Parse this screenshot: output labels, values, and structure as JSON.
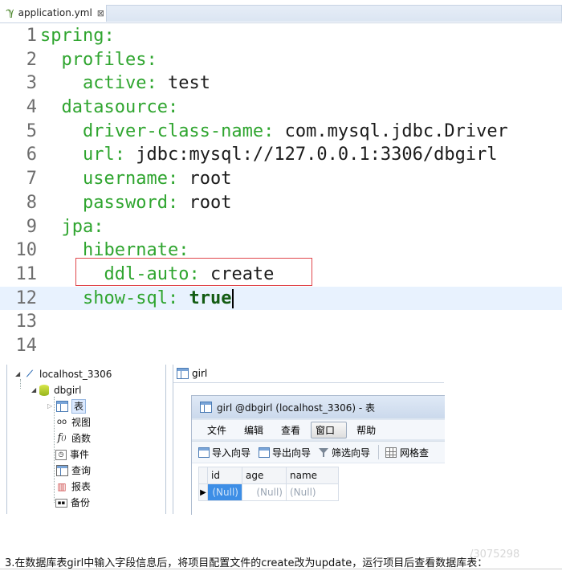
{
  "editor": {
    "tab_title": "application.yml",
    "tab_close": "⊠",
    "lines": [
      {
        "num": "1",
        "indent": "",
        "key": "spring:",
        "value": ""
      },
      {
        "num": "2",
        "indent": "  ",
        "key": "profiles:",
        "value": ""
      },
      {
        "num": "3",
        "indent": "    ",
        "key": "active:",
        "value": "test"
      },
      {
        "num": "4",
        "indent": "  ",
        "key": "datasource:",
        "value": ""
      },
      {
        "num": "5",
        "indent": "    ",
        "key": "driver-class-name:",
        "value": "com.mysql.jdbc.Driver"
      },
      {
        "num": "6",
        "indent": "    ",
        "key": "url:",
        "value": "jdbc:mysql://127.0.0.1:3306/dbgirl"
      },
      {
        "num": "7",
        "indent": "    ",
        "key": "username:",
        "value": "root"
      },
      {
        "num": "8",
        "indent": "    ",
        "key": "password:",
        "value": "root"
      },
      {
        "num": "9",
        "indent": "  ",
        "key": "jpa:",
        "value": ""
      },
      {
        "num": "10",
        "indent": "    ",
        "key": "hibernate:",
        "value": ""
      },
      {
        "num": "11",
        "indent": "      ",
        "key": "ddl-auto:",
        "value": "create"
      },
      {
        "num": "12",
        "indent": "    ",
        "key": "show-sql:",
        "value": "true",
        "bold": true,
        "current": true
      },
      {
        "num": "13",
        "indent": "",
        "key": "",
        "value": ""
      },
      {
        "num": "14",
        "indent": "",
        "key": "",
        "value": ""
      }
    ],
    "highlight_color": "#e0474c"
  },
  "navigator": {
    "items": [
      {
        "label": "localhost_3306",
        "icon": "connection-icon"
      },
      {
        "label": "dbgirl",
        "icon": "database-icon"
      },
      {
        "label": "表",
        "icon": "table-icon"
      },
      {
        "label": "视图",
        "icon": "view-icon"
      },
      {
        "label": "函数",
        "icon": "function-icon"
      },
      {
        "label": "事件",
        "icon": "event-icon"
      },
      {
        "label": "查询",
        "icon": "query-icon"
      },
      {
        "label": "报表",
        "icon": "report-icon"
      },
      {
        "label": "备份",
        "icon": "backup-icon"
      }
    ]
  },
  "object_tab": {
    "label": "girl"
  },
  "table_window": {
    "title": "girl @dbgirl (localhost_3306) - 表",
    "menus": [
      "文件",
      "编辑",
      "查看",
      "窗口",
      "帮助"
    ],
    "active_menu": "窗口",
    "toolbar": [
      "导入向导",
      "导出向导",
      "筛选向导",
      "网格查"
    ],
    "columns": [
      "id",
      "age",
      "name"
    ],
    "row": [
      "(Null)",
      "(Null)",
      "(Null)"
    ],
    "row_marker": "▶"
  },
  "caption": "3.在数据库表girl中输入字段信息后，将项目配置文件的create改为update，运行项目后查看数据库表：",
  "watermark": "/3075298"
}
